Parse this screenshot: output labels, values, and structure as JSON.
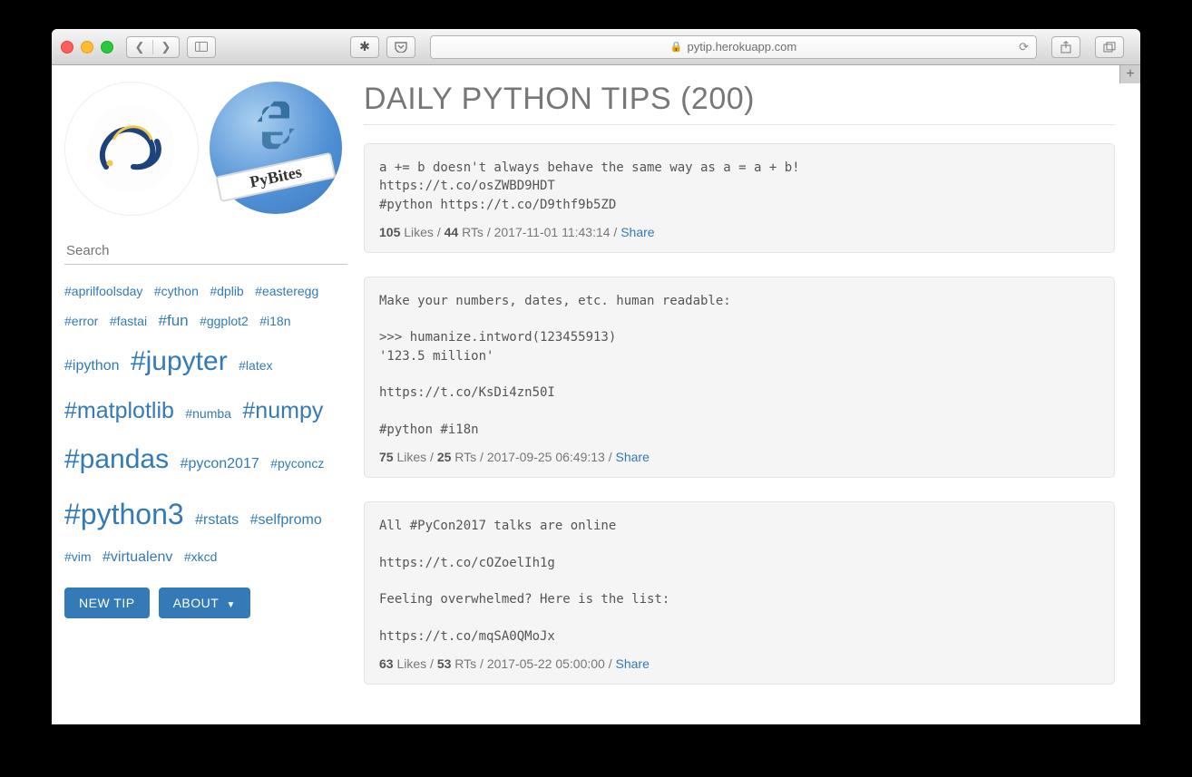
{
  "browser": {
    "url_host": "pytip.herokuapp.com",
    "ribbon_text": "PyBites"
  },
  "sidebar": {
    "search_placeholder": "Search",
    "tags": [
      {
        "label": "#aprilfoolsday",
        "size": 1
      },
      {
        "label": "#cython",
        "size": 1
      },
      {
        "label": "#dplib",
        "size": 1
      },
      {
        "label": "#easteregg",
        "size": 1
      },
      {
        "label": "#error",
        "size": 1
      },
      {
        "label": "#fastai",
        "size": 1
      },
      {
        "label": "#fun",
        "size": 3
      },
      {
        "label": "#ggplot2",
        "size": 1
      },
      {
        "label": "#i18n",
        "size": 1
      },
      {
        "label": "#ipython",
        "size": 2
      },
      {
        "label": "#jupyter",
        "size": 6
      },
      {
        "label": "#latex",
        "size": 1
      },
      {
        "label": "#matplotlib",
        "size": 5
      },
      {
        "label": "#numba",
        "size": 1
      },
      {
        "label": "#numpy",
        "size": 5
      },
      {
        "label": "#pandas",
        "size": 6
      },
      {
        "label": "#pycon2017",
        "size": 2
      },
      {
        "label": "#pyconcz",
        "size": 1
      },
      {
        "label": "#python3",
        "size": 7
      },
      {
        "label": "#rstats",
        "size": 2
      },
      {
        "label": "#selfpromo",
        "size": 2
      },
      {
        "label": "#vim",
        "size": 1
      },
      {
        "label": "#virtualenv",
        "size": 2
      },
      {
        "label": "#xkcd",
        "size": 1
      }
    ],
    "buttons": {
      "new_tip": "NEW TIP",
      "about": "ABOUT"
    }
  },
  "main": {
    "title": "DAILY PYTHON TIPS (200)",
    "meta_labels": {
      "likes": "Likes",
      "rts": "RTs",
      "share": "Share"
    },
    "tips": [
      {
        "text": "a += b doesn't always behave the same way as a = a + b!\nhttps://t.co/osZWBD9HDT\n#python https://t.co/D9thf9b5ZD",
        "likes": "105",
        "rts": "44",
        "ts": "2017-11-01 11:43:14"
      },
      {
        "text": "Make your numbers, dates, etc. human readable:\n\n>>> humanize.intword(123455913)\n'123.5 million'\n\nhttps://t.co/KsDi4zn50I\n\n#python #i18n",
        "likes": "75",
        "rts": "25",
        "ts": "2017-09-25 06:49:13"
      },
      {
        "text": "All #PyCon2017 talks are online\n\nhttps://t.co/cOZoelIh1g\n\nFeeling overwhelmed? Here is the list:\n\nhttps://t.co/mqSA0QMoJx",
        "likes": "63",
        "rts": "53",
        "ts": "2017-05-22 05:00:00"
      }
    ]
  }
}
